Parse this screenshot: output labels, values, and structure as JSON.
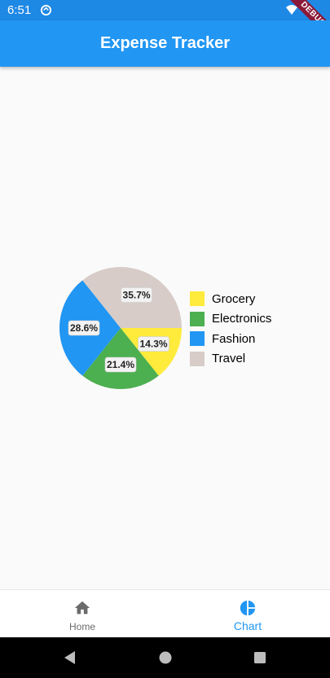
{
  "status_bar": {
    "time": "6:51",
    "app_icon": "sync-icon",
    "wifi_icon": "wifi-icon",
    "battery_icon": "battery-icon"
  },
  "debug_banner": "DEBUG",
  "app_bar": {
    "title": "Expense Tracker"
  },
  "chart_data": {
    "type": "pie",
    "categories": [
      "Grocery",
      "Electronics",
      "Fashion",
      "Travel"
    ],
    "values": [
      14.3,
      21.4,
      28.6,
      35.7
    ],
    "labels": [
      "14.3%",
      "21.4%",
      "28.6%",
      "35.7%"
    ],
    "colors": [
      "#ffeb3b",
      "#4caf50",
      "#2196f3",
      "#d7ccc8"
    ],
    "legend_position": "right"
  },
  "legend": [
    {
      "label": "Grocery",
      "color": "#ffeb3b"
    },
    {
      "label": "Electronics",
      "color": "#4caf50"
    },
    {
      "label": "Fashion",
      "color": "#2196f3"
    },
    {
      "label": "Travel",
      "color": "#d7ccc8"
    }
  ],
  "bottom_nav": {
    "items": [
      {
        "label": "Home",
        "icon": "home-icon",
        "active": false
      },
      {
        "label": "Chart",
        "icon": "pie-chart-icon",
        "active": true
      }
    ],
    "active_color": "#2196f3",
    "inactive_color": "#6b6b6b"
  },
  "system_nav": {
    "back": "back-icon",
    "home": "home-circle-icon",
    "recents": "recents-icon"
  }
}
